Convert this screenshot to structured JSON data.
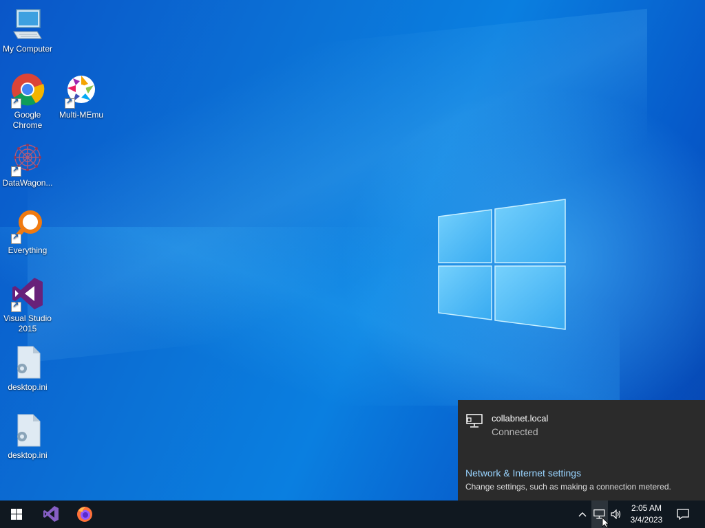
{
  "desktop": {
    "icons": [
      {
        "label": "My Computer",
        "icon": "my-computer-icon"
      },
      {
        "label": "Google Chrome",
        "icon": "chrome-icon",
        "shortcut": true
      },
      {
        "label": "Multi-MEmu",
        "icon": "multi-memu-icon",
        "shortcut": true
      },
      {
        "label": "DataWagon...",
        "icon": "datawagon-icon",
        "shortcut": true
      },
      {
        "label": "Everything",
        "icon": "everything-search-icon",
        "shortcut": true
      },
      {
        "label": "Visual Studio 2015",
        "icon": "visual-studio-icon",
        "shortcut": true
      },
      {
        "label": "desktop.ini",
        "icon": "settings-file-icon"
      },
      {
        "label": "desktop.ini",
        "icon": "settings-file-icon"
      }
    ]
  },
  "network_flyout": {
    "network_name": "collabnet.local",
    "status": "Connected",
    "settings_link": "Network & Internet settings",
    "settings_description": "Change settings, such as making a connection metered."
  },
  "taskbar": {
    "start_icon": "windows-start-icon",
    "pinned": [
      {
        "name": "visual-studio-icon"
      },
      {
        "name": "firefox-icon"
      }
    ],
    "tray": {
      "show_hidden_icon": "chevron-up-icon",
      "network_icon": "network-ethernet-icon",
      "volume_icon": "speaker-icon"
    },
    "clock": {
      "time": "2:05 AM",
      "date": "3/4/2023"
    },
    "notifications_icon": "action-center-icon"
  },
  "colors": {
    "desktop_blue": "#0a72d6",
    "taskbar": "#101820",
    "flyout_bg": "#2b2b2b",
    "link": "#99d4ff"
  }
}
